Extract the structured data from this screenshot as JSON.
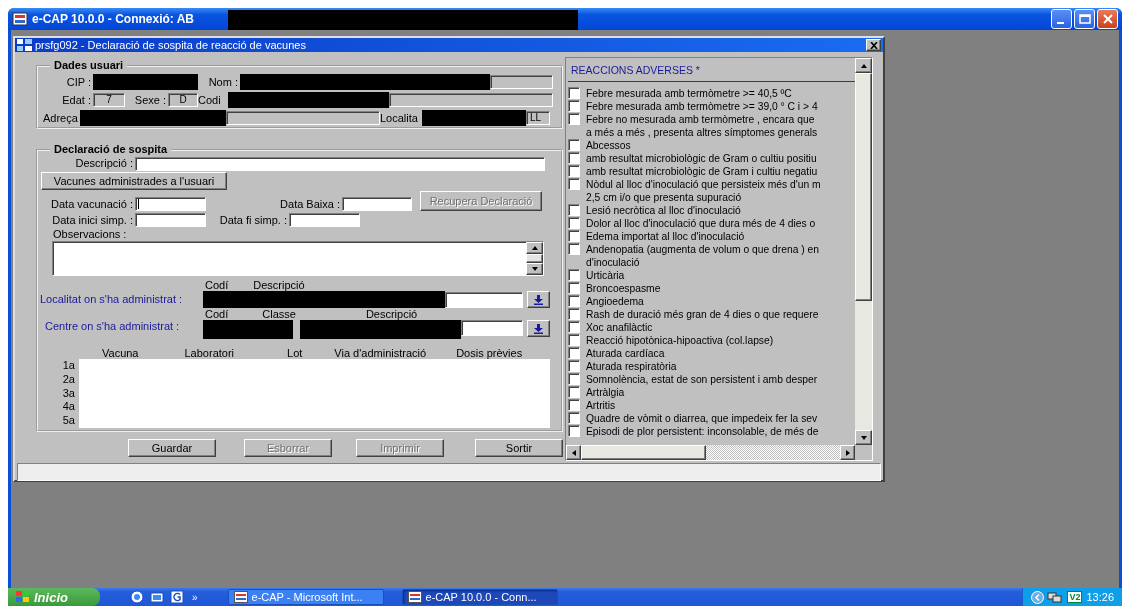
{
  "window": {
    "title": "e-CAP 10.0.0 - Connexió: AB"
  },
  "dialog": {
    "title": "prsfg092 - Declaració de sospita de reacció de vacunes"
  },
  "user_data": {
    "title": "Dades usuari",
    "cip_label": "CIP :",
    "nom_label": "Nom :",
    "edat_label": "Edat :",
    "edat_value": "7",
    "sexe_label": "Sexe :",
    "sexe_value": "D",
    "codi_label": "Codi",
    "adreca_label": "Adreça",
    "localitat_label": "Localita",
    "localitat_value": "LL"
  },
  "declaration": {
    "title": "Declaració de sospita",
    "descripcio_label": "Descripció :",
    "vacunes_button": "Vacunes administrades a l'usuari",
    "data_vacunacio_label": "Data vacunació :",
    "data_baixa_label": "Data Baixa :",
    "recupera_button": {
      "label": "Recupera Declaració",
      "disabled": true
    },
    "data_inici_label": "Data inici simp. :",
    "data_fi_label": "Data fi simp. :",
    "observacions_label": "Observacions :",
    "localitat": {
      "label": "Localitat on s'ha administrat :",
      "columns": [
        "Codí",
        "Descripció"
      ]
    },
    "centre": {
      "label": "Centre on s'ha administrat :",
      "columns": [
        "Codí",
        "Classe",
        "Descripció"
      ]
    },
    "vaccines": {
      "columns": [
        "Vacuna",
        "Laboratori",
        "Lot",
        "Via d'administració",
        "Dosis prèvies"
      ],
      "rows": [
        "1a",
        "2a",
        "3a",
        "4a",
        "5a"
      ]
    }
  },
  "buttons": [
    {
      "label": "Guardar",
      "disabled": false
    },
    {
      "label": "Esborrar",
      "disabled": true
    },
    {
      "label": "Imprimir",
      "disabled": true
    },
    {
      "label": "Sortir",
      "disabled": false
    }
  ],
  "reactions": {
    "title": "REACCIONS ADVERSES *",
    "items": [
      {
        "lines": [
          "Febre mesurada amb termòmetre >= 40,5 ºC"
        ],
        "checked": false
      },
      {
        "lines": [
          "Febre mesurada amb termòmetre >= 39,0 ° C i > 4"
        ],
        "checked": false
      },
      {
        "lines": [
          "Febre no mesurada amb termòmetre , encara que",
          "a més a més , presenta altres símptomes generals"
        ],
        "checked": false
      },
      {
        "lines": [
          "Abcessos"
        ],
        "checked": false
      },
      {
        "lines": [
          "amb resultat microbiològic de Gram o cultiu positiu"
        ],
        "checked": false
      },
      {
        "lines": [
          "amb resultat microbiològic de Gram i cultiu negatiu"
        ],
        "checked": false
      },
      {
        "lines": [
          "Nòdul al lloc d'inoculació que persisteix més d'un m",
          "2,5 cm i/o que presenta supuració"
        ],
        "checked": false
      },
      {
        "lines": [
          "Lesió necròtica al lloc d'inoculació"
        ],
        "checked": false
      },
      {
        "lines": [
          "Dolor al lloc d'inoculació que dura més de 4 dies o"
        ],
        "checked": false
      },
      {
        "lines": [
          "Edema importat al lloc d'inoculació"
        ],
        "checked": false
      },
      {
        "lines": [
          "Andenopatia (augmenta de volum o que drena ) en",
          "d'inoculació"
        ],
        "checked": false
      },
      {
        "lines": [
          "Urticària"
        ],
        "checked": false
      },
      {
        "lines": [
          "Broncoespasme"
        ],
        "checked": false
      },
      {
        "lines": [
          "Angioedema"
        ],
        "checked": false
      },
      {
        "lines": [
          "Rash de duració més gran de 4 dies o que requere"
        ],
        "checked": false
      },
      {
        "lines": [
          "Xoc anafilàctic"
        ],
        "checked": false
      },
      {
        "lines": [
          "Reacció hipotònica-hipoactiva (col.lapse)"
        ],
        "checked": false
      },
      {
        "lines": [
          "Aturada cardíaca"
        ],
        "checked": false
      },
      {
        "lines": [
          "Aturada respiratòria"
        ],
        "checked": false
      },
      {
        "lines": [
          "Somnolència, estat de son persistent i amb desper"
        ],
        "checked": false
      },
      {
        "lines": [
          "Artràlgia"
        ],
        "checked": false
      },
      {
        "lines": [
          "Artritis"
        ],
        "checked": false
      },
      {
        "lines": [
          "Quadre de vòmit o diarrea, que impedeix fer la sev"
        ],
        "checked": false
      },
      {
        "lines": [
          "Episodi de plor persistent: inconsolable, de més de"
        ],
        "checked": false
      }
    ]
  },
  "taskbar": {
    "start": "Inicio",
    "more": "»",
    "tasks": [
      {
        "label": "e-CAP - Microsoft Int...",
        "selected": false
      },
      {
        "label": "e-CAP 10.0.0 - Conn...",
        "selected": true
      }
    ],
    "tray_label": "V2",
    "clock": "13:26"
  }
}
